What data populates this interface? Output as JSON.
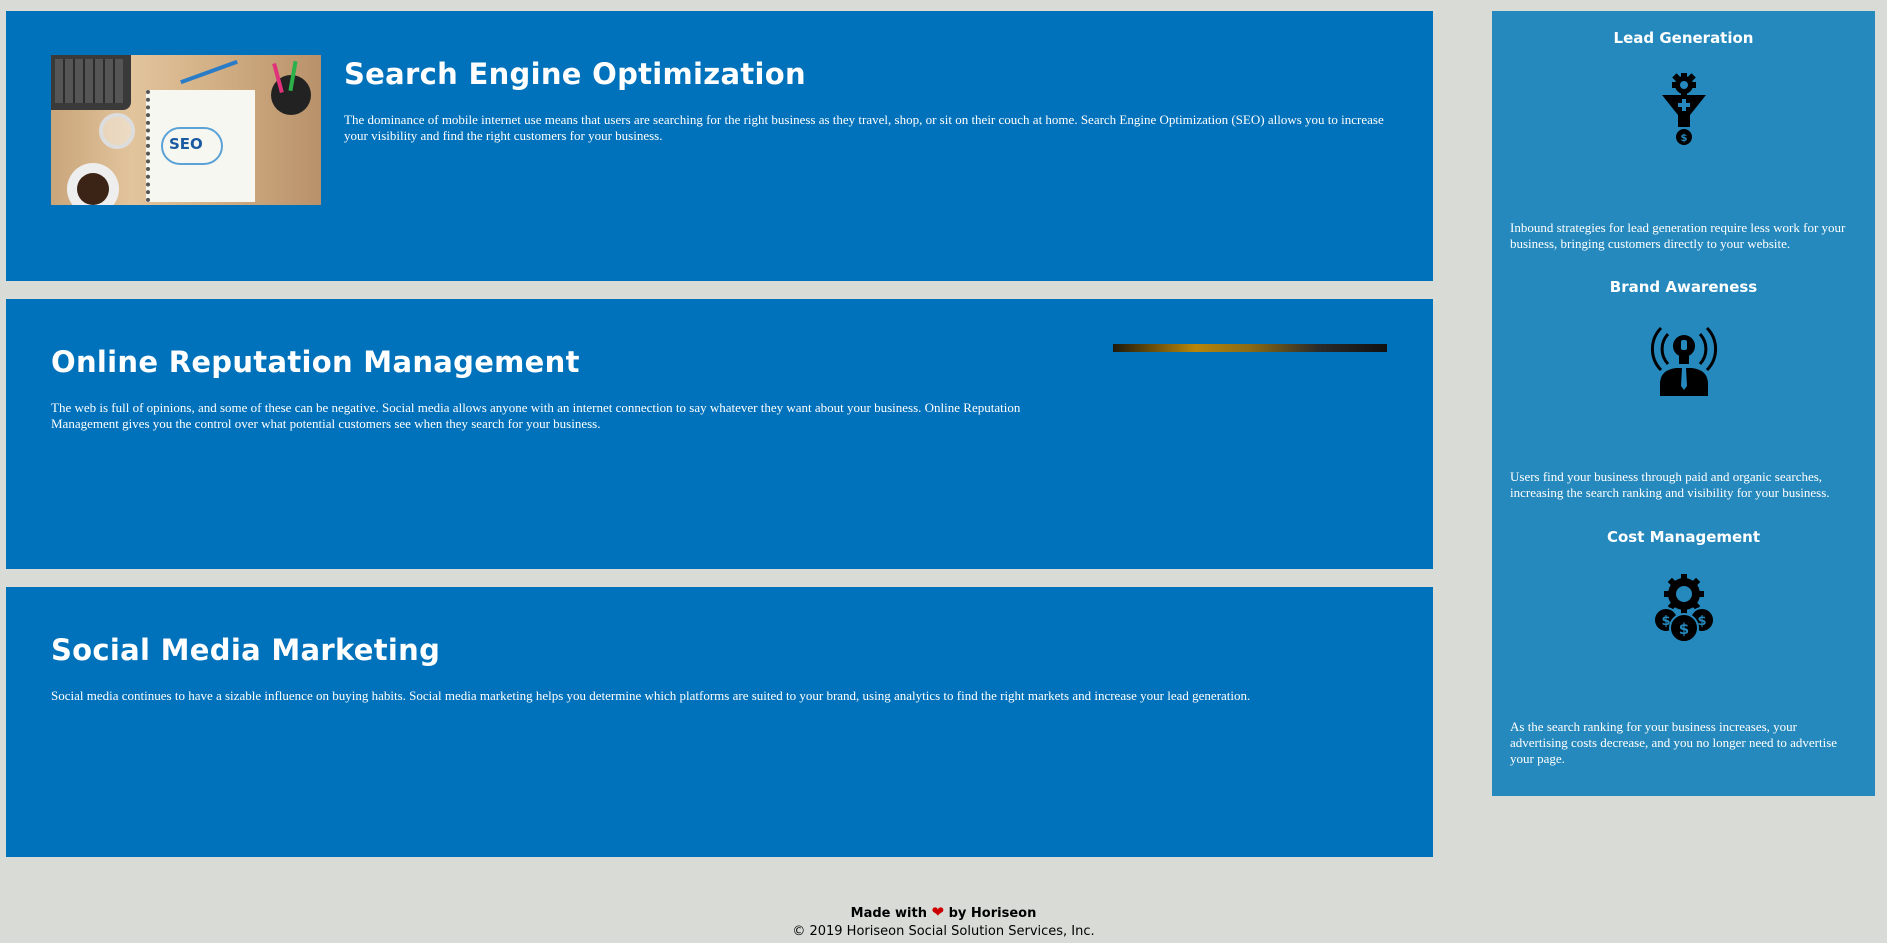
{
  "services": [
    {
      "title": "Search Engine Optimization",
      "text": "The dominance of mobile internet use means that users are searching for the right business as they travel, shop, or sit on their couch at home. Search Engine Optimization (SEO) allows you to increase your visibility and find the right customers for your business."
    },
    {
      "title": "Online Reputation Management",
      "text": "The web is full of opinions, and some of these can be negative. Social media allows anyone with an internet connection to say whatever they want about your business. Online Reputation Management gives you the control over what potential customers see when they search for your business."
    },
    {
      "title": "Social Media Marketing",
      "text": "Social media continues to have a sizable influence on buying habits. Social media marketing helps you determine which platforms are suited to your brand, using analytics to find the right markets and increase your lead generation."
    }
  ],
  "seo_image": {
    "text": "SEO",
    "icon": "seo-desk-photo"
  },
  "benefits": [
    {
      "title": "Lead Generation",
      "icon": "funnel-gear-dollar-icon",
      "text": "Inbound strategies for lead generation require less work for your business, bringing customers directly to your website."
    },
    {
      "title": "Brand Awareness",
      "icon": "lightbulb-person-icon",
      "text": "Users find your business through paid and organic searches, increasing the search ranking and visibility for your business."
    },
    {
      "title": "Cost Management",
      "icon": "gear-coins-icon",
      "text": "As the search ranking for your business increases, your advertising costs decrease, and you no longer need to advertise your page."
    }
  ],
  "footer": {
    "made_prefix": "Made with",
    "heart": "❤",
    "made_suffix": "by Horiseon",
    "copyright": "© 2019 Horiseon Social Solution Services, Inc."
  },
  "colors": {
    "page_background": "#d9dcd6",
    "service_background": "#0072bb",
    "benefits_background": "#2589bd",
    "heart": "#cc0000"
  }
}
